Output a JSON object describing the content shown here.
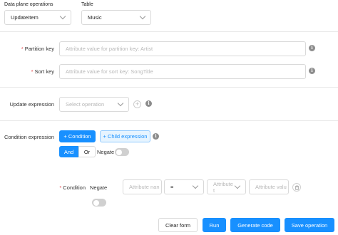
{
  "top": {
    "operations_label": "Data plane operations",
    "operations_value": "UpdateItem",
    "table_label": "Table",
    "table_value": "Music"
  },
  "keys": {
    "partition_label": "Partition key",
    "partition_placeholder": "Attribute value for partition key: Artist",
    "sort_label": "Sort key",
    "sort_placeholder": "Attribute value for sort key: SongTitle",
    "required_mark": "*"
  },
  "update": {
    "label": "Update expression",
    "select_placeholder": "Select operation",
    "add_glyph": "+"
  },
  "condition_expr": {
    "label": "Condition expression",
    "condition_btn": "+ Condition",
    "child_btn": "+ Child expression",
    "and_label": "And",
    "or_label": "Or",
    "negate_label": "Negate"
  },
  "condition_row": {
    "label": "Condition",
    "negate_label": "Negate",
    "attr_name_placeholder": "Attribute nan",
    "operator_value": "=",
    "attr_type_placeholder": "Attribute t",
    "attr_value_placeholder": "Attribute valu"
  },
  "footer": {
    "clear": "Clear form",
    "run": "Run",
    "generate": "Generate code",
    "save": "Save operation"
  },
  "colors": {
    "primary": "#1890ff",
    "required": "#e5484d"
  },
  "icons": {
    "info": "info-circle-icon",
    "chevron": "chevron-down-icon",
    "add": "plus-circle-icon",
    "delete": "trash-icon"
  }
}
